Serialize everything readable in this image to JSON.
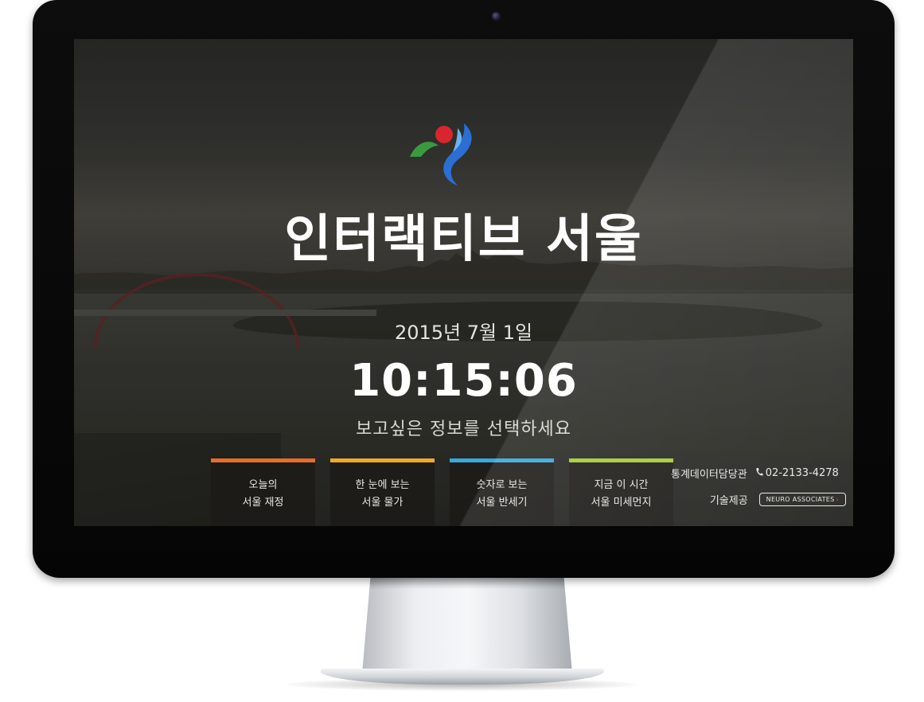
{
  "hero": {
    "title": "인터랙티브 서울",
    "date": "2015년 7월 1일",
    "clock": "10:15:06",
    "prompt": "보고싶은 정보를 선택하세요"
  },
  "menu": [
    {
      "line1": "오늘의",
      "line2": "서울 재정",
      "accent": "#e56e2a"
    },
    {
      "line1": "한 눈에 보는",
      "line2": "서울 물가",
      "accent": "#f0a927"
    },
    {
      "line1": "숫자로 보는",
      "line2": "서울 반세기",
      "accent": "#3aa7d8"
    },
    {
      "line1": "지금 이 시간",
      "line2": "서울 미세먼지",
      "accent": "#a6c93a"
    }
  ],
  "info": {
    "department": "통계데이터담당관",
    "phone_icon": "phone-icon",
    "phone": "02-2133-4278",
    "tech_label": "기술제공",
    "vendor": "NEURO ASSOCIATES",
    "vendor_arrow": "›"
  },
  "logo": {
    "icon": "seoul-logo-icon",
    "colors": {
      "green": "#3a9a3e",
      "red": "#d8262f",
      "blue": "#2a6fd1"
    }
  }
}
